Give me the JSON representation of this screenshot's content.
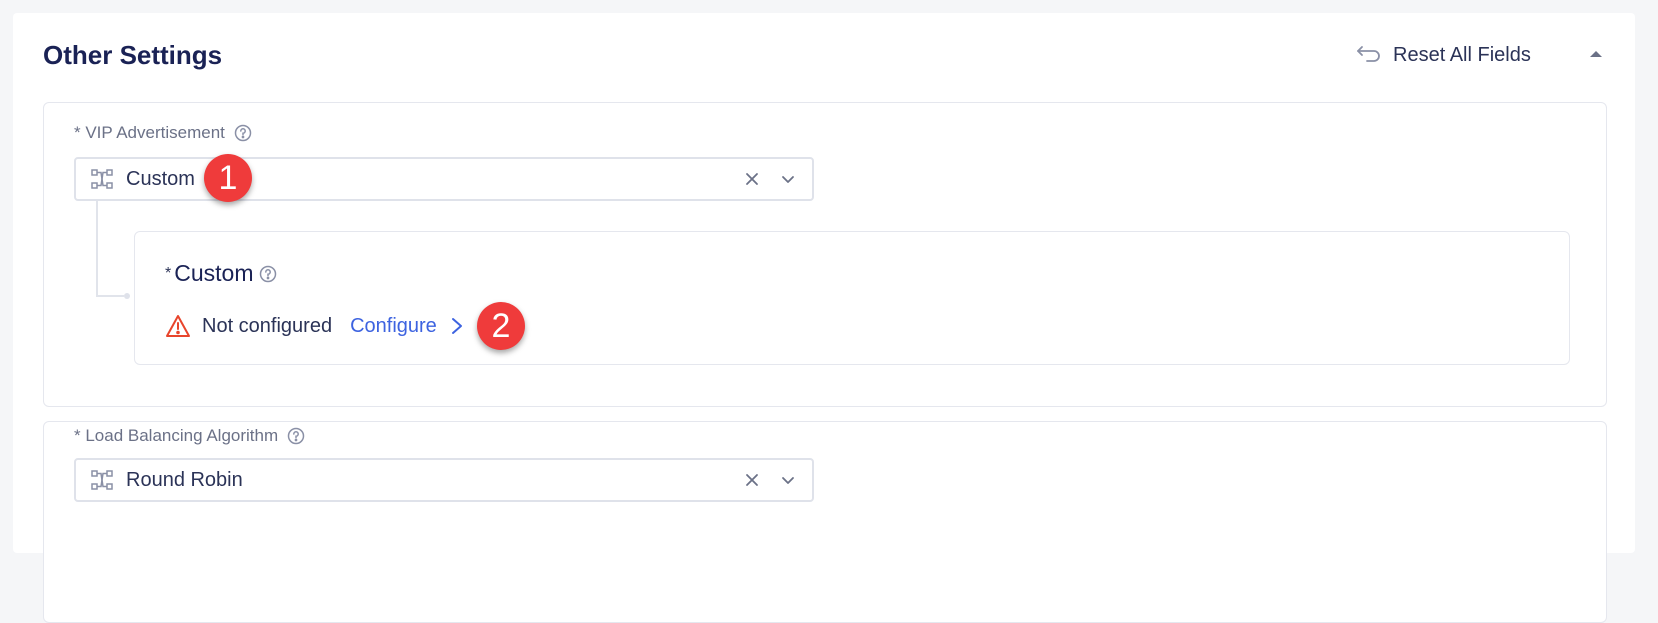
{
  "section": {
    "title": "Other Settings",
    "reset_label": "Reset All Fields"
  },
  "vip": {
    "label": "* VIP Advertisement",
    "value": "Custom",
    "badge": "1",
    "custom": {
      "star": "*",
      "title": "Custom",
      "status": "Not configured",
      "action": "Configure",
      "badge": "2"
    }
  },
  "lb": {
    "label": "* Load Balancing Algorithm",
    "value": "Round Robin"
  },
  "colors": {
    "accent": "#3d63e0",
    "badge": "#ef3b3b",
    "warning": "#e8452c",
    "title": "#1a2255"
  }
}
